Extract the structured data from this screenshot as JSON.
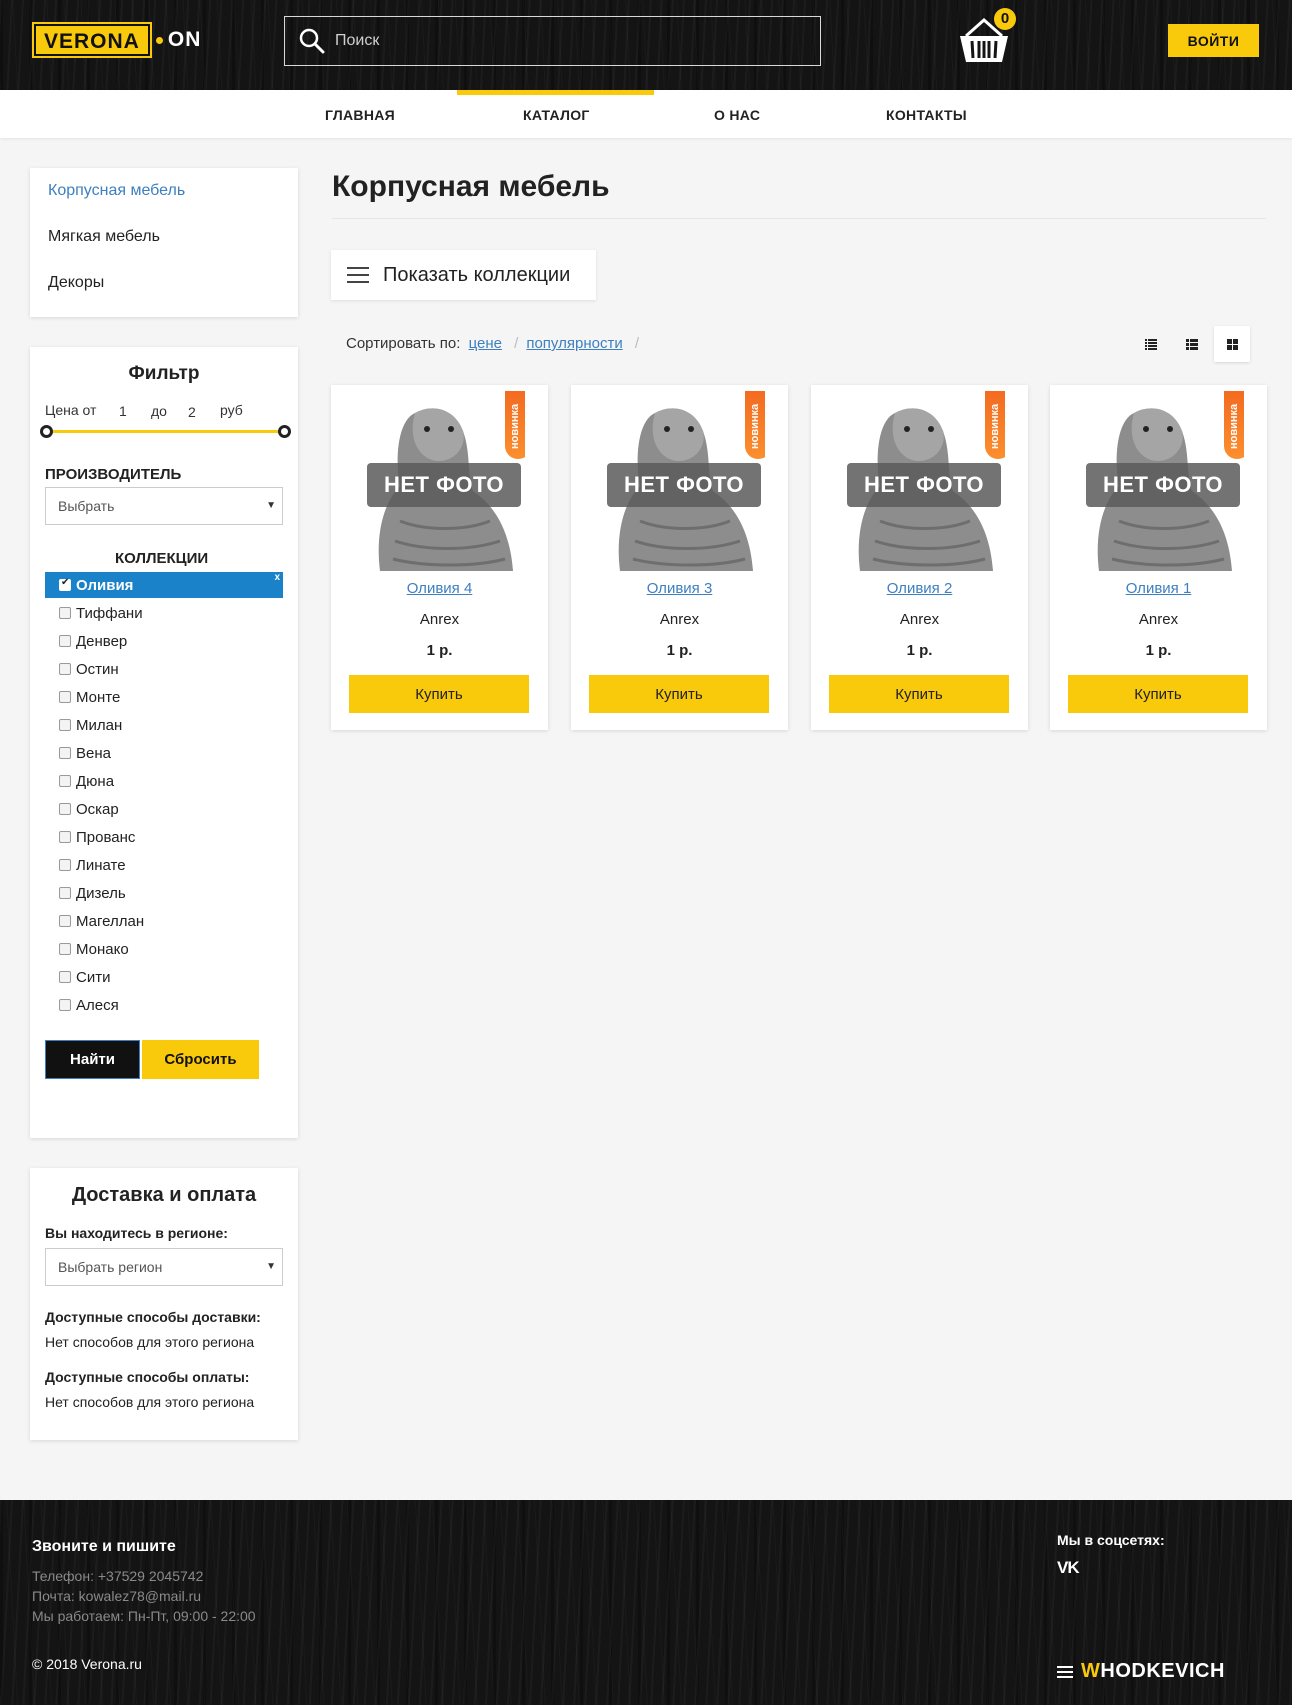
{
  "header": {
    "logo_left": "VERONA",
    "logo_right": "ON",
    "search_placeholder": "Поиск",
    "cart_count": "0",
    "login_label": "ВОЙТИ"
  },
  "nav": {
    "items": [
      "ГЛАВНАЯ",
      "КАТАЛОГ",
      "О НАС",
      "КОНТАКТЫ"
    ],
    "active": "КАТАЛОГ"
  },
  "sidebar": {
    "categories": [
      "Корпусная мебель",
      "Мягкая мебель",
      "Декоры"
    ],
    "active_category": "Корпусная мебель",
    "filter": {
      "title": "Фильтр",
      "price_from_label": "Цена от",
      "price_from": "1",
      "price_to_label": "до",
      "price_to": "2",
      "price_unit": "руб",
      "manufacturer_label": "ПРОИЗВОДИТЕЛЬ",
      "manufacturer_value": "Выбрать",
      "collections_label": "КОЛЛЕКЦИИ",
      "collections": [
        "Оливия",
        "Тиффани",
        "Денвер",
        "Остин",
        "Монте",
        "Милан",
        "Вена",
        "Дюна",
        "Оскар",
        "Прованс",
        "Линате",
        "Дизель",
        "Магеллан",
        "Монако",
        "Сити",
        "Алеся"
      ],
      "selected_collection": "Оливия",
      "clear_mark": "x",
      "find_label": "Найти",
      "reset_label": "Сбросить"
    },
    "delivery": {
      "title": "Доставка и оплата",
      "region_label": "Вы находитесь в регионе:",
      "region_value": "Выбрать регион",
      "shipping_label": "Доступные способы доставки:",
      "shipping_value": "Нет способов для этого региона",
      "payment_label": "Доступные способы оплаты:",
      "payment_value": "Нет способов для этого региона"
    }
  },
  "main": {
    "title": "Корпусная мебель",
    "show_collections_label": "Показать коллекции",
    "sort_label": "Сортировать по:",
    "sort_options": [
      "цене",
      "популярности"
    ],
    "view_modes": [
      "list-detailed-icon",
      "list-icon",
      "grid-icon"
    ],
    "active_view": "grid-icon",
    "products": [
      {
        "name": "Оливия 4",
        "brand": "Anrex",
        "price": "1 р.",
        "badge": "новинка",
        "photo_text": "НЕТ ФОТО",
        "buy_label": "Купить"
      },
      {
        "name": "Оливия 3",
        "brand": "Anrex",
        "price": "1 р.",
        "badge": "новинка",
        "photo_text": "НЕТ ФОТО",
        "buy_label": "Купить"
      },
      {
        "name": "Оливия 2",
        "brand": "Anrex",
        "price": "1 р.",
        "badge": "новинка",
        "photo_text": "НЕТ ФОТО",
        "buy_label": "Купить"
      },
      {
        "name": "Оливия 1",
        "brand": "Anrex",
        "price": "1 р.",
        "badge": "новинка",
        "photo_text": "НЕТ ФОТО",
        "buy_label": "Купить"
      }
    ]
  },
  "footer": {
    "contact_title": "Звоните и пишите",
    "phone": "Телефон: +37529 2045742",
    "email": "Почта: kowalez78@mail.ru",
    "hours": "Мы работаем: Пн-Пт, 09:00 - 22:00",
    "copyright": "© 2018 Verona.ru",
    "social_title": "Мы в соцсетях:",
    "social_vk": "VK",
    "developer_first": "W",
    "developer_rest": "HODKEVICH"
  },
  "colors": {
    "accent": "#f9c90c",
    "link": "#3d7fc1",
    "selected": "#1a82c8",
    "badge": "#f36b21",
    "dark": "#141414"
  }
}
